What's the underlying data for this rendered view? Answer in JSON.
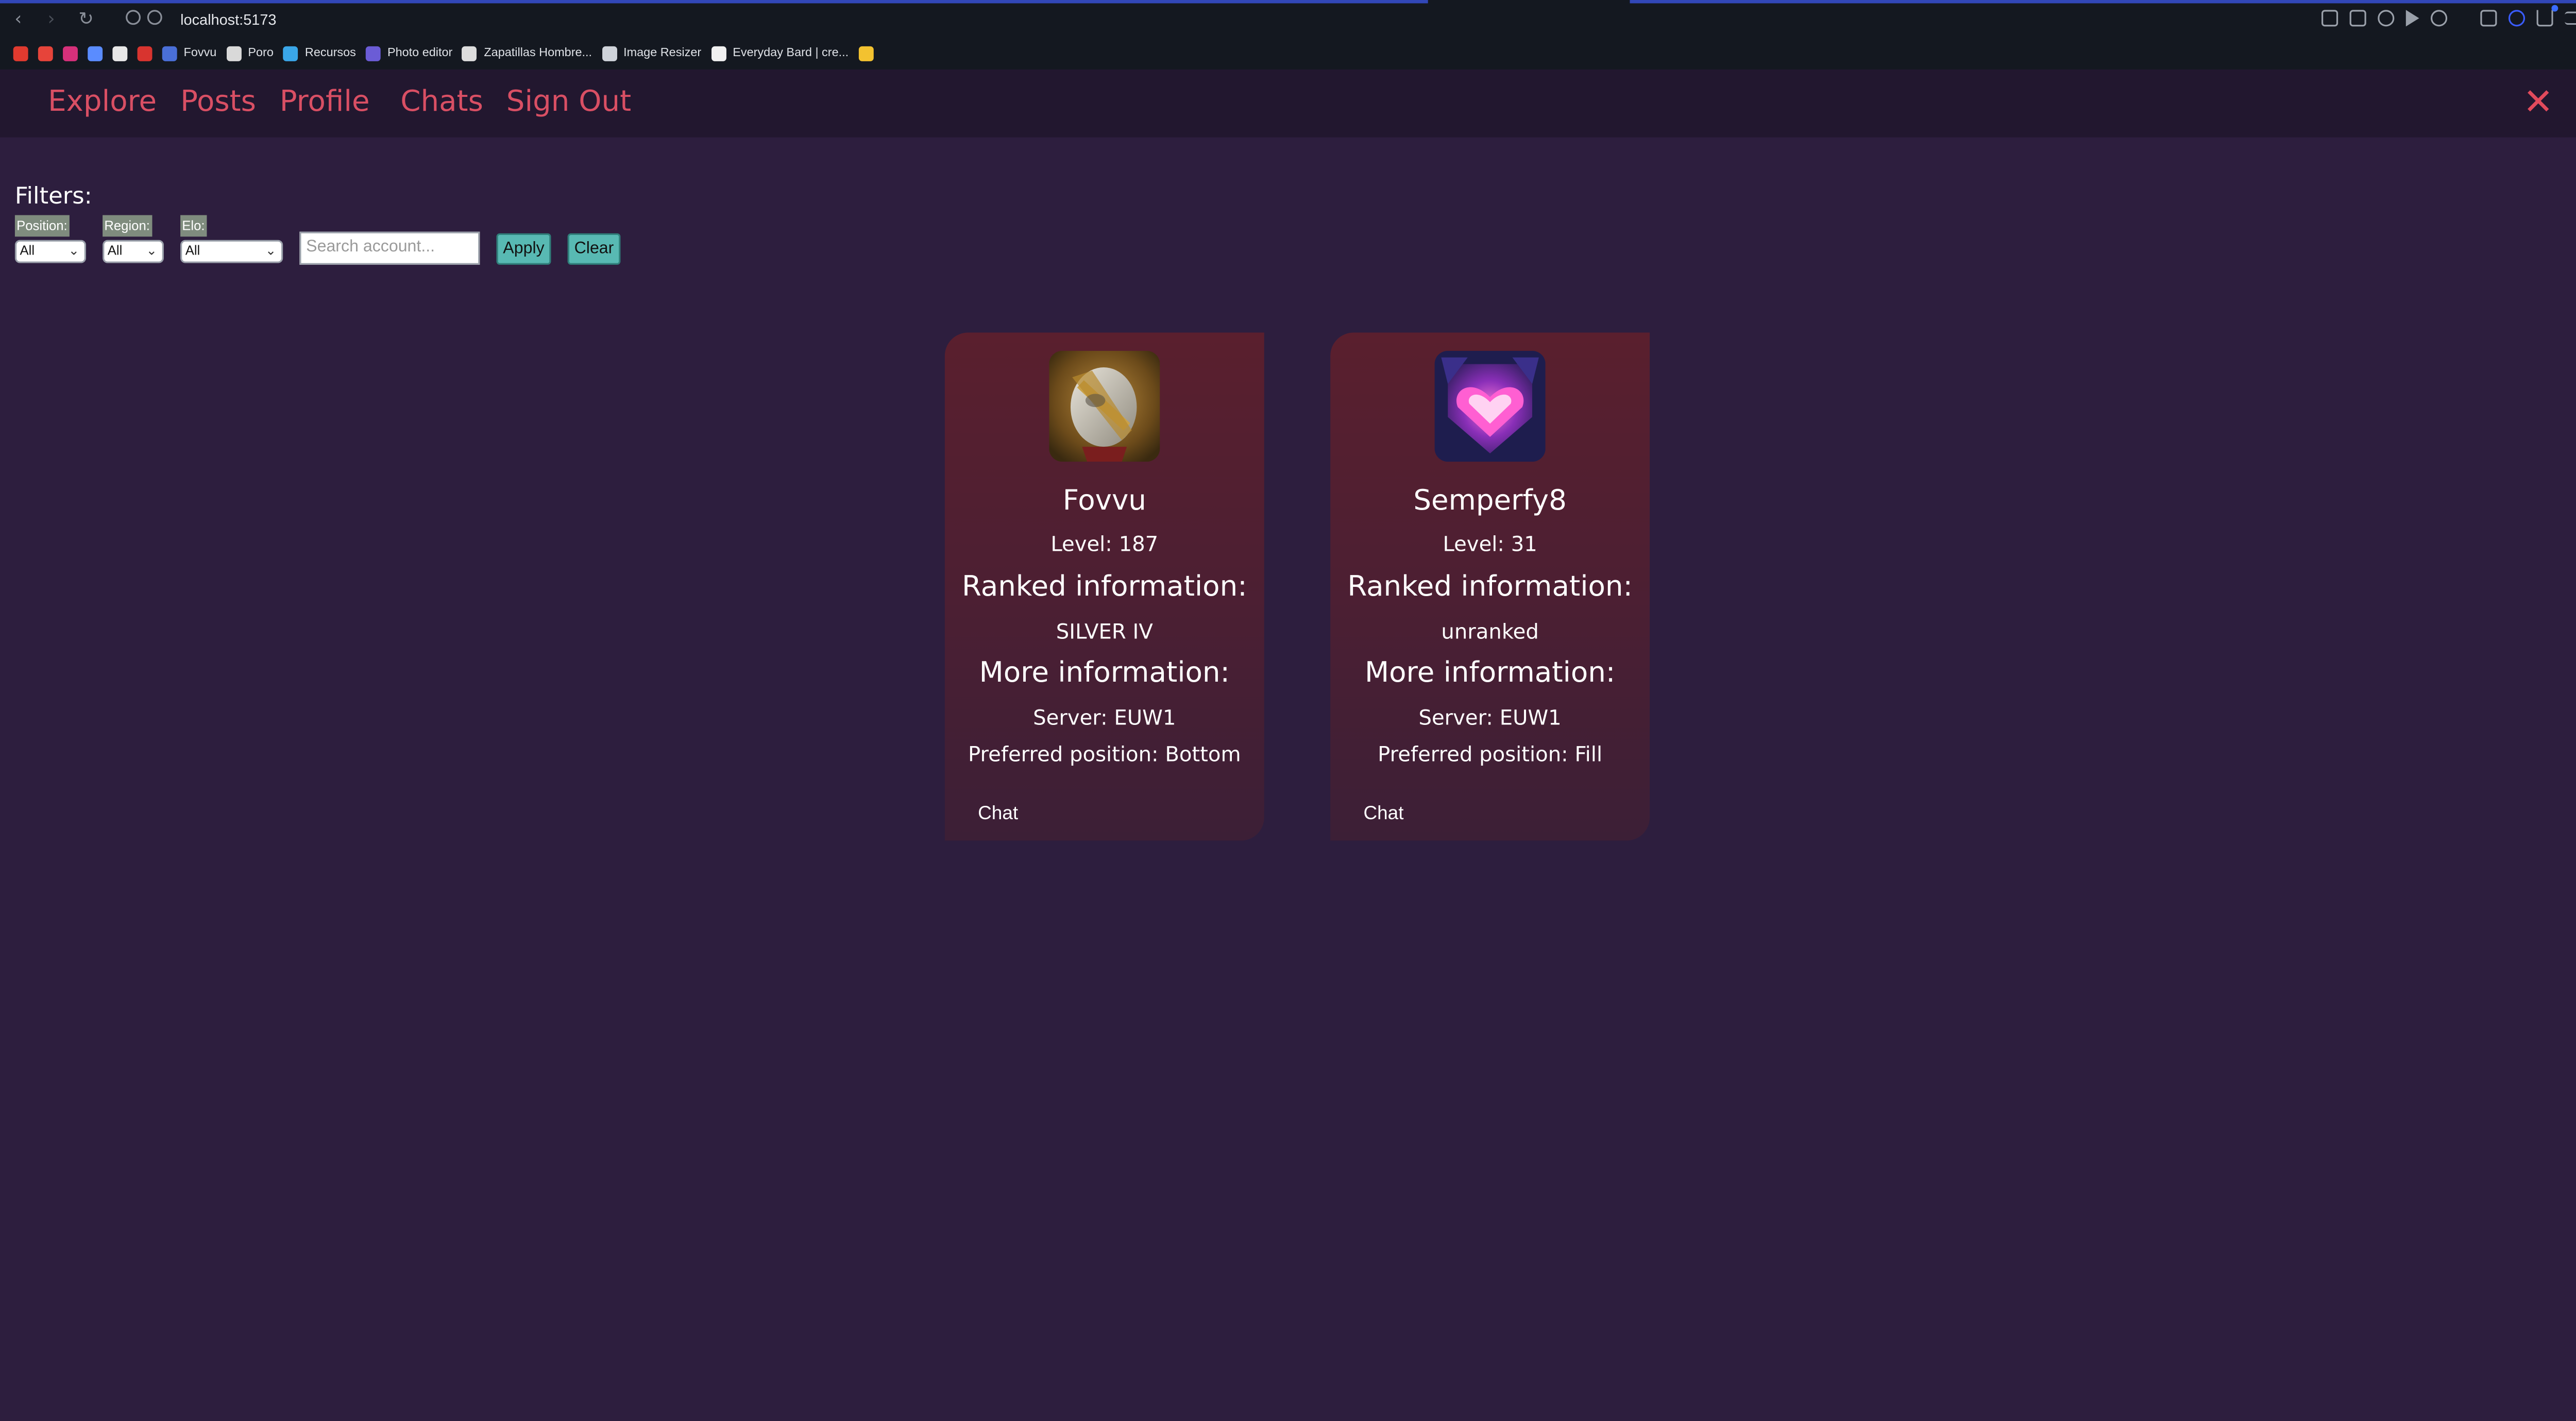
{
  "browser": {
    "url": "localhost:5173",
    "bookmarks": [
      {
        "label": "",
        "icon": "youtube-icon",
        "color": "#e03a2f"
      },
      {
        "label": "",
        "icon": "gmail-icon",
        "color": "#e6443a"
      },
      {
        "label": "",
        "icon": "instagram-icon",
        "color": "#d6307a"
      },
      {
        "label": "",
        "icon": "moon-icon",
        "color": "#5a8cff"
      },
      {
        "label": "",
        "icon": "document-icon",
        "color": "#e8e8e8"
      },
      {
        "label": "",
        "icon": "shield-icon",
        "color": "#d8342f"
      },
      {
        "label": "Fovvu",
        "icon": "fovvu-bookmark-icon",
        "color": "#4a6fd8"
      },
      {
        "label": "Poro",
        "icon": "poro-bookmark-icon",
        "color": "#d9d9d9"
      },
      {
        "label": "Recursos",
        "icon": "recursos-bookmark-icon",
        "color": "#3aa6e8"
      },
      {
        "label": "Photo editor",
        "icon": "photo-editor-icon",
        "color": "#6b5cd6"
      },
      {
        "label": "Zapatillas Hombre...",
        "icon": "zapatillas-icon",
        "color": "#dddddd"
      },
      {
        "label": "Image Resizer",
        "icon": "image-resizer-icon",
        "color": "#cfd3da"
      },
      {
        "label": "Everyday Bard | cre...",
        "icon": "bard-icon",
        "color": "#f0f0f0"
      },
      {
        "label": "",
        "icon": "google-drive-icon",
        "color": "#f3c230"
      }
    ]
  },
  "nav": {
    "links": [
      "Explore",
      "Posts",
      "Profile",
      "Chats",
      "Sign Out"
    ],
    "close_symbol": "✕"
  },
  "filters": {
    "title": "Filters:",
    "position_label": "Position:",
    "position_value": "All",
    "region_label": "Region:",
    "region_value": "All",
    "elo_label": "Elo:",
    "elo_value": "All",
    "search_placeholder": "Search account...",
    "apply_label": "Apply",
    "clear_label": "Clear"
  },
  "cards": [
    {
      "name": "Fovvu",
      "level": "Level: 187",
      "ranked_heading": "Ranked information:",
      "rank": "SILVER IV",
      "more_heading": "More information:",
      "server": "Server: EUW1",
      "preferred_position": "Preferred position: Bottom",
      "chat_label": "Chat",
      "avatar_icon": "armored-knight-icon"
    },
    {
      "name": "Semperfy8",
      "level": "Level: 31",
      "ranked_heading": "Ranked information:",
      "rank": "unranked",
      "more_heading": "More information:",
      "server": "Server: EUW1",
      "preferred_position": "Preferred position: Fill",
      "chat_label": "Chat",
      "avatar_icon": "heart-emblem-icon"
    }
  ],
  "colors": {
    "page_background": "#2d1e3e",
    "nav_background": "#22172f",
    "nav_link": "#d94f64",
    "card_background": "#561f30",
    "button_teal": "#58b9b3",
    "filter_label_bg": "#7f8c7e"
  }
}
